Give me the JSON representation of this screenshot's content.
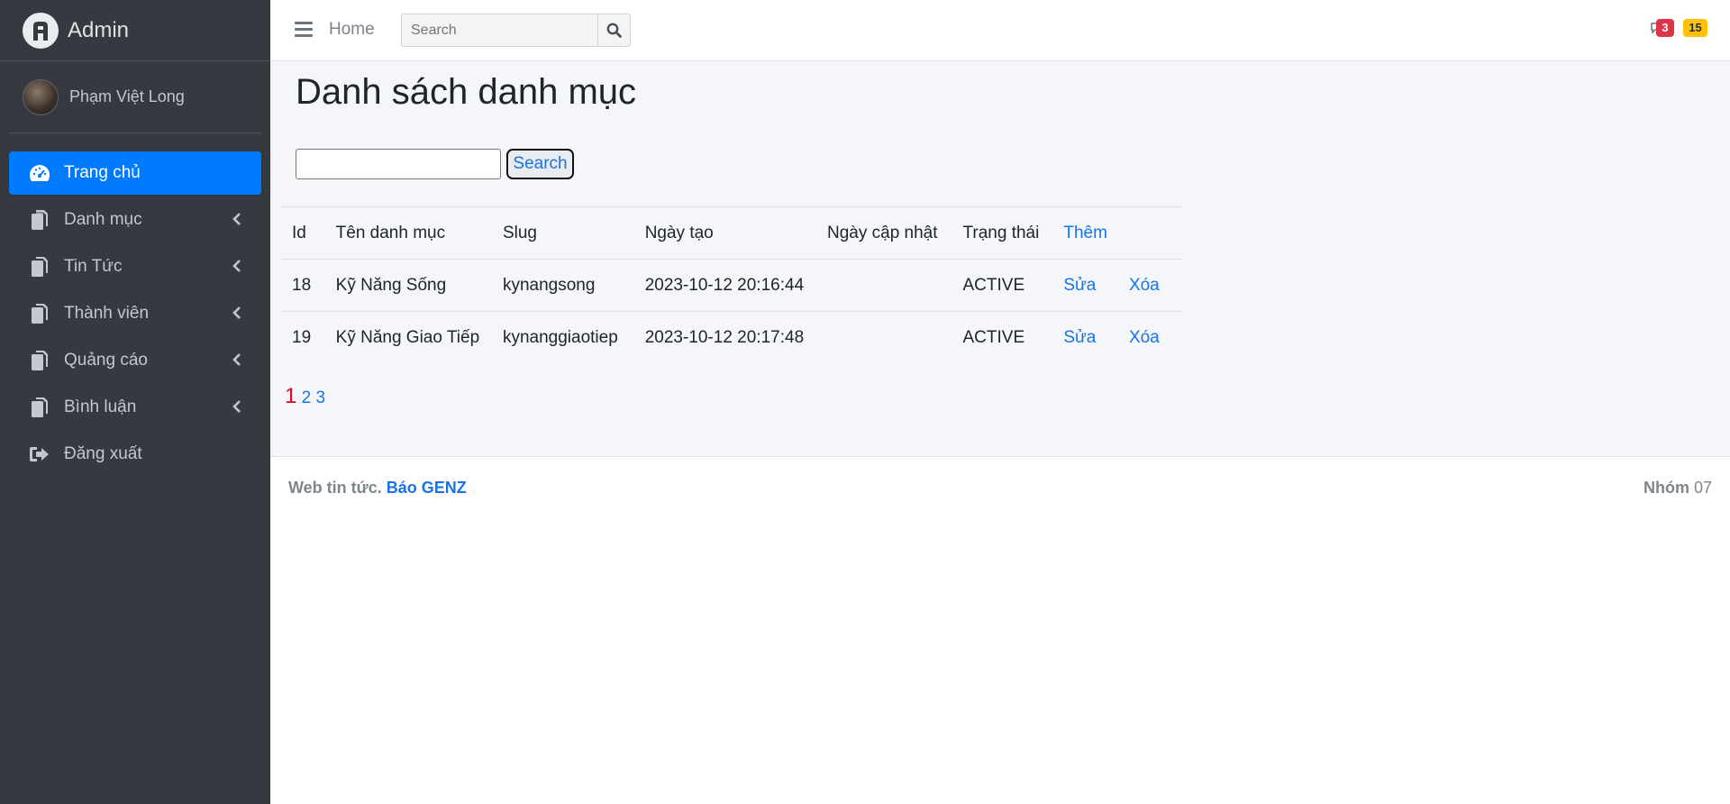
{
  "brand": {
    "title": "Admin"
  },
  "user": {
    "name": "Phạm Việt Long"
  },
  "sidebar": {
    "items": [
      {
        "label": "Trang chủ",
        "icon": "dashboard-icon",
        "active": true
      },
      {
        "label": "Danh mục",
        "icon": "copy-icon",
        "expandable": true
      },
      {
        "label": "Tin Tức",
        "icon": "copy-icon",
        "expandable": true
      },
      {
        "label": "Thành viên",
        "icon": "copy-icon",
        "expandable": true
      },
      {
        "label": "Quảng cáo",
        "icon": "copy-icon",
        "expandable": true
      },
      {
        "label": "Bình luận",
        "icon": "copy-icon",
        "expandable": true
      },
      {
        "label": "Đăng xuất",
        "icon": "sign-out-icon"
      }
    ]
  },
  "topbar": {
    "home_label": "Home",
    "search_placeholder": "Search",
    "badges": {
      "messages": "3",
      "notifications": "15"
    }
  },
  "main": {
    "title": "Danh sách danh mục",
    "filter": {
      "value": "",
      "button_label": "Search"
    },
    "table": {
      "headers": [
        "Id",
        "Tên danh mục",
        "Slug",
        "Ngày tạo",
        "Ngày cập nhật",
        "Trạng thái"
      ],
      "add_label": "Thêm",
      "rows": [
        {
          "id": "18",
          "name": "Kỹ Năng Sống",
          "slug": "kynangsong",
          "created": "2023-10-12 20:16:44",
          "updated": "",
          "status": "ACTIVE",
          "edit": "Sửa",
          "delete": "Xóa"
        },
        {
          "id": "19",
          "name": "Kỹ Năng Giao Tiếp",
          "slug": "kynanggiaotiep",
          "created": "2023-10-12 20:17:48",
          "updated": "",
          "status": "ACTIVE",
          "edit": "Sửa",
          "delete": "Xóa"
        }
      ]
    },
    "pagination": {
      "current": "1",
      "pages": [
        "2",
        "3"
      ]
    }
  },
  "footer": {
    "text": "Web tin tức.",
    "brand_link": "Báo GENZ",
    "group_label": "Nhóm",
    "group_number": "07"
  },
  "colors": {
    "sidebar_bg": "#343a40",
    "accent": "#007bff",
    "link": "#1a73e8",
    "badge_red": "#dc3545",
    "badge_yellow": "#ffc107",
    "page_current": "#e3001b"
  }
}
